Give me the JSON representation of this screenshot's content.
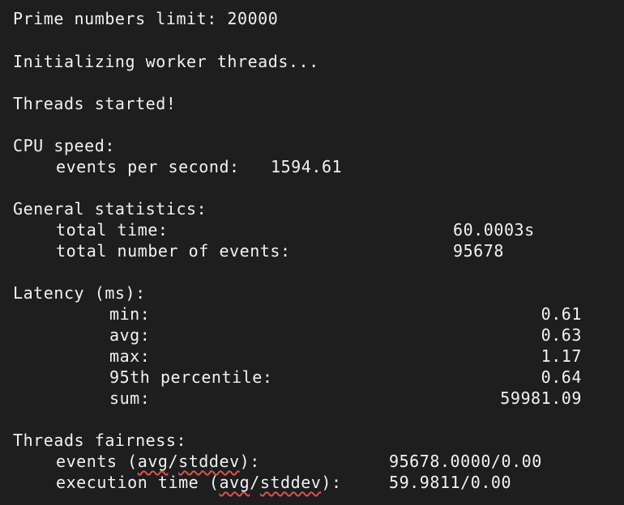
{
  "terminal": {
    "prime_limit": "Prime numbers limit: 20000",
    "init": "Initializing worker threads...",
    "started": "Threads started!",
    "cpu": {
      "heading": "CPU speed:",
      "eps_label": "events per second:",
      "eps_value": "1594.61"
    },
    "general": {
      "heading": "General statistics:",
      "total_time_label": "total time:",
      "total_time_value": "60.0003s",
      "total_events_label": "total number of events:",
      "total_events_value": "95678"
    },
    "latency": {
      "heading": "Latency (ms):",
      "min_label": "min:",
      "min_value": "0.61",
      "avg_label": "avg:",
      "avg_value": "0.63",
      "max_label": "max:",
      "max_value": "1.17",
      "p95_label": "95th percentile:",
      "p95_value": "0.64",
      "sum_label": "sum:",
      "sum_value": "59981.09"
    },
    "fairness": {
      "heading": "Threads fairness:",
      "events_label_pre": "events (",
      "events_label_avg": "avg",
      "events_label_sep": "/",
      "events_label_std": "stddev",
      "events_label_post": "):",
      "events_value": "95678.0000/0.00",
      "exec_label_pre": "execution time (",
      "exec_label_avg": "avg",
      "exec_label_sep": "/",
      "exec_label_std": "stddev",
      "exec_label_post": "):",
      "exec_value": "59.9811/0.00"
    }
  }
}
